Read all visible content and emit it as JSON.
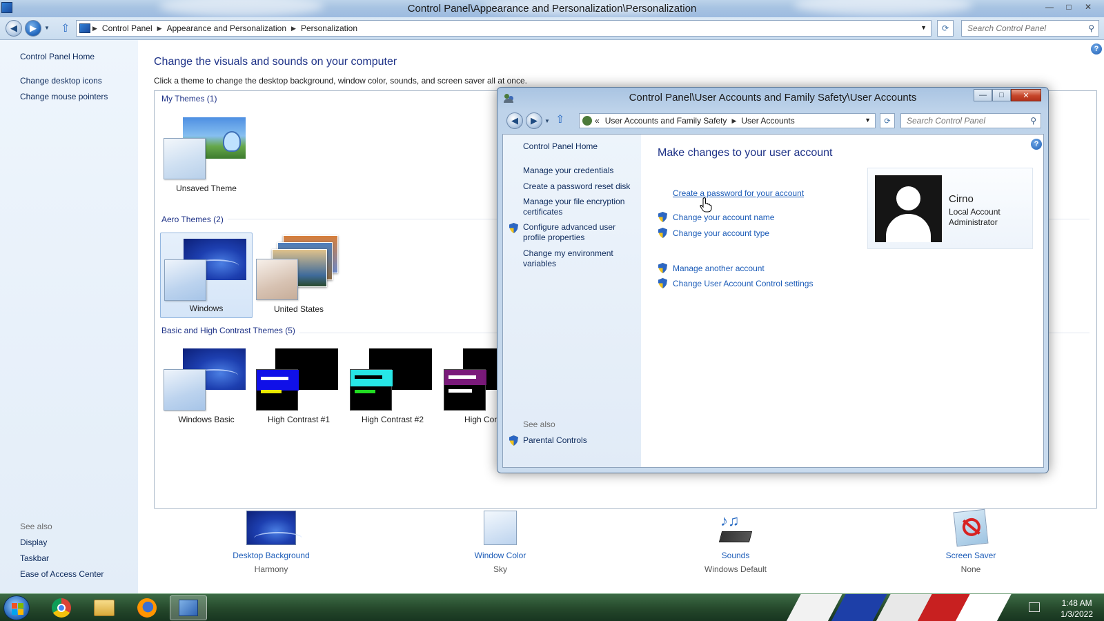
{
  "main_window": {
    "title": "Control Panel\\Appearance and Personalization\\Personalization",
    "breadcrumbs": [
      "Control Panel",
      "Appearance and Personalization",
      "Personalization"
    ],
    "search_placeholder": "Search Control Panel",
    "controls": {
      "minimize": "—",
      "maximize": "□",
      "close": "✕"
    }
  },
  "sidebar": {
    "home": "Control Panel Home",
    "links": [
      "Change desktop icons",
      "Change mouse pointers"
    ],
    "see_also_label": "See also",
    "see_also": [
      "Display",
      "Taskbar",
      "Ease of Access Center"
    ]
  },
  "content": {
    "title": "Change the visuals and sounds on your computer",
    "subtitle": "Click a theme to change the desktop background, window color, sounds, and screen saver all at once.",
    "groups": [
      {
        "header": "My Themes (1)",
        "themes": [
          "Unsaved Theme"
        ]
      },
      {
        "header": "Aero Themes (2)",
        "themes": [
          "Windows",
          "United States"
        ]
      },
      {
        "header": "Basic and High Contrast Themes (5)",
        "themes": [
          "Windows Basic",
          "High Contrast #1",
          "High Contrast #2",
          "High Contra"
        ]
      }
    ],
    "bottom_items": [
      {
        "title": "Desktop Background",
        "value": "Harmony"
      },
      {
        "title": "Window Color",
        "value": "Sky"
      },
      {
        "title": "Sounds",
        "value": "Windows Default"
      },
      {
        "title": "Screen Saver",
        "value": "None"
      }
    ]
  },
  "dialog": {
    "title": "Control Panel\\User Accounts and Family Safety\\User Accounts",
    "breadcrumbs": [
      "«",
      "User Accounts and Family Safety",
      "User Accounts"
    ],
    "search_placeholder": "Search Control Panel",
    "sidebar": {
      "home": "Control Panel Home",
      "links": [
        "Manage your credentials",
        "Create a password reset disk",
        "Manage your file encryption certificates",
        "Configure advanced user profile properties",
        "Change my environment variables"
      ],
      "see_also_label": "See also",
      "see_also": [
        "Parental Controls"
      ]
    },
    "main_title": "Make changes to your user account",
    "tasks": [
      "Create a password for your account",
      "Change your account name",
      "Change your account type"
    ],
    "other_tasks": [
      "Manage another account",
      "Change User Account Control settings"
    ],
    "account": {
      "name": "Cirno",
      "type": "Local Account",
      "role": "Administrator"
    }
  },
  "taskbar": {
    "time": "1:48 AM",
    "date": "1/3/2022"
  }
}
